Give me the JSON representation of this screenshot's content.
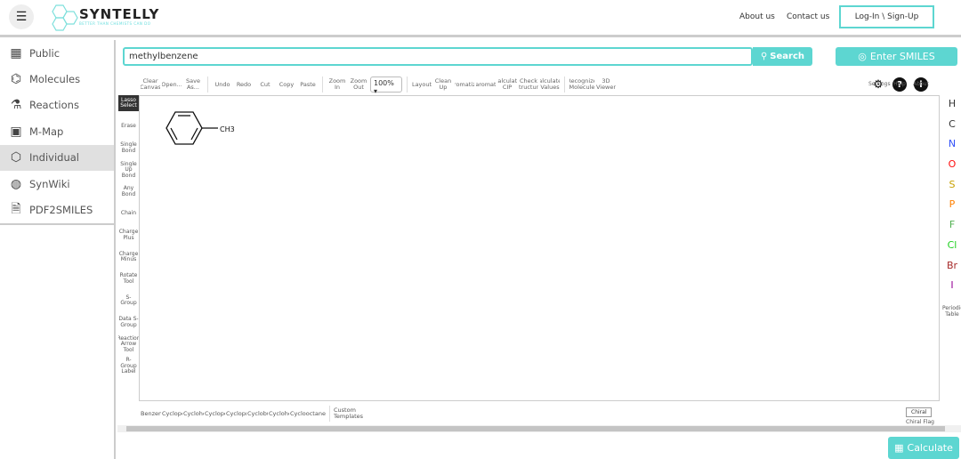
{
  "header": {
    "brand": "SYNTELLY",
    "tagline": "BETTER THAN CHEMISTS CAN DO",
    "nav": [
      "About us",
      "Contact us"
    ],
    "login": "Log-In \\ Sign-Up"
  },
  "sidebar": {
    "items": [
      {
        "label": "Public",
        "icon": "database-icon"
      },
      {
        "label": "Molecules",
        "icon": "molecules-icon"
      },
      {
        "label": "Reactions",
        "icon": "flask-icon"
      },
      {
        "label": "M-Map",
        "icon": "map-icon"
      },
      {
        "label": "Individual",
        "icon": "hexagon-icon",
        "active": true
      },
      {
        "label": "SynWiki",
        "icon": "globe-icon"
      },
      {
        "label": "PDF2SMILES",
        "icon": "pdf-icon"
      }
    ]
  },
  "search": {
    "value": "methylbenzene",
    "button": "Search"
  },
  "enter_smiles": "Enter SMILES",
  "toolbar": {
    "g1": [
      "Clear Canvas",
      "Open...",
      "Save As..."
    ],
    "g2": [
      "Undo",
      "Redo",
      "Cut",
      "Copy",
      "Paste"
    ],
    "g3": [
      "Zoom In",
      "Zoom Out"
    ],
    "zoom": "100%",
    "g4": [
      "Layout",
      "Clean Up",
      "Aromatize",
      "Dearomatize",
      "Calculate CIP",
      "Check Structure",
      "Calculated Values",
      "Recognize Molecule",
      "3D Viewer"
    ],
    "right": [
      "Settings",
      "Help",
      "About"
    ]
  },
  "left_tools": [
    "Lasso Select",
    "Erase",
    "Single Bond",
    "Single Up Bond",
    "Any Bond",
    "Chain",
    "Charge Plus",
    "Charge Minus",
    "Rotate Tool",
    "S-Group",
    "Data S-Group",
    "Reaction Arrow Tool",
    "R-Group Label"
  ],
  "atoms": [
    {
      "s": "H",
      "c": "#333333"
    },
    {
      "s": "C",
      "c": "#333333"
    },
    {
      "s": "N",
      "c": "#3050f8"
    },
    {
      "s": "O",
      "c": "#ff0d0d"
    },
    {
      "s": "S",
      "c": "#c8a000"
    },
    {
      "s": "P",
      "c": "#ff8000"
    },
    {
      "s": "F",
      "c": "#50b050"
    },
    {
      "s": "Cl",
      "c": "#1ff01f"
    },
    {
      "s": "Br",
      "c": "#a62929"
    },
    {
      "s": "I",
      "c": "#940094"
    }
  ],
  "periodic_table": "Periodic Table",
  "molecule": {
    "label": "CH3"
  },
  "templates": [
    "Benzene",
    "Cyclopentadiene",
    "Cyclohexane",
    "Cyclopentane",
    "Cyclopropane",
    "Cyclobutane",
    "Cycloheptane",
    "Cyclooctane"
  ],
  "custom_templates": "Custom Templates",
  "chiral": "Chiral",
  "chiral_flag": "Chiral Flag",
  "calculate": "Calculate",
  "accent": "#5dd6d1"
}
